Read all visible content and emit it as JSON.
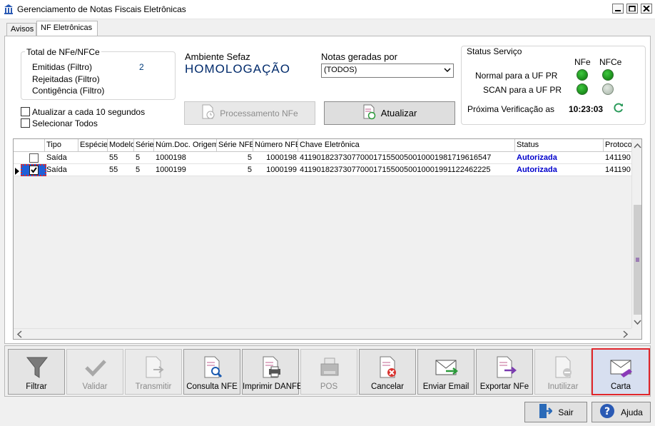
{
  "window": {
    "title": "Gerenciamento de Notas Fiscais Eletrônicas"
  },
  "tabs": [
    {
      "label": "Avisos",
      "active": false
    },
    {
      "label": "NF Eletrônicas",
      "active": true
    }
  ],
  "totals": {
    "title": "Total de NFe/NFCe",
    "emitidas_label": "Emitidas (Filtro)",
    "emitidas_value": "2",
    "rejeitadas_label": "Rejeitadas (Filtro)",
    "contingencia_label": "Contigência (Filtro)"
  },
  "options": {
    "auto_refresh_label": "Atualizar a cada 10 segundos",
    "select_all_label": "Selecionar Todos"
  },
  "ambiente": {
    "label": "Ambiente Sefaz",
    "value": "HOMOLOGAÇÃO"
  },
  "notas_geradas": {
    "label": "Notas geradas por",
    "selected": "(TODOS)"
  },
  "buttons": {
    "processamento": "Processamento NFe",
    "atualizar": "Atualizar"
  },
  "status_servico": {
    "title": "Status Serviço",
    "col_nfe": "NFe",
    "col_nfce": "NFCe",
    "rows": [
      {
        "label": "Normal para a UF PR",
        "nfe": "online",
        "nfce": "online"
      },
      {
        "label": "SCAN para a UF PR",
        "nfe": "online",
        "nfce": "offline"
      }
    ],
    "proxima_label": "Próxima Verificação as",
    "proxima_value": "10:23:03"
  },
  "grid": {
    "columns": [
      "Tipo",
      "Espécie",
      "Modelo",
      "Série",
      "Núm.Doc. Origem",
      "Série NFE",
      "Número NFE",
      "Chave Eletrônica",
      "Status",
      "Protoco"
    ],
    "rows": [
      {
        "selected": false,
        "current": false,
        "tipo": "Saída",
        "especie": "",
        "modelo": "55",
        "serie": "5",
        "num_doc": "1000198",
        "serie_nfe": "5",
        "numero_nfe": "1000198",
        "chave": "41190182373077000171550050010001981719616547",
        "status": "Autorizada",
        "protocolo": "141190"
      },
      {
        "selected": true,
        "current": true,
        "tipo": "Saída",
        "especie": "",
        "modelo": "55",
        "serie": "5",
        "num_doc": "1000199",
        "serie_nfe": "5",
        "numero_nfe": "1000199",
        "chave": "41190182373077000171550050010001991122462225",
        "status": "Autorizada",
        "protocolo": "141190"
      }
    ]
  },
  "toolbar": [
    {
      "label": "Filtrar",
      "icon": "filter-icon",
      "enabled": true
    },
    {
      "label": "Validar",
      "icon": "check-icon",
      "enabled": false
    },
    {
      "label": "Transmitir",
      "icon": "transmit-icon",
      "enabled": false
    },
    {
      "label": "Consulta NFE",
      "icon": "search-document-icon",
      "enabled": true
    },
    {
      "label": "Imprimir DANFE",
      "icon": "print-document-icon",
      "enabled": true
    },
    {
      "label": "POS",
      "icon": "pos-printer-icon",
      "enabled": false
    },
    {
      "label": "Cancelar",
      "icon": "cancel-document-icon",
      "enabled": true
    },
    {
      "label": "Enviar Email",
      "icon": "email-send-icon",
      "enabled": true
    },
    {
      "label": "Exportar NFe",
      "icon": "export-document-icon",
      "enabled": true
    },
    {
      "label": "Inutilizar",
      "icon": "void-document-icon",
      "enabled": false
    },
    {
      "label": "Carta",
      "icon": "letter-icon",
      "enabled": true
    }
  ],
  "footer": {
    "sair": "Sair",
    "ajuda": "Ajuda"
  },
  "colors": {
    "status_authorized": "#0000cc",
    "ambiente_text": "#002a6b",
    "emitidas_value": "#003b7a",
    "highlight_border": "#e0262b",
    "online_dot": "#1a8c1a",
    "offline_dot": "#b8c4b8"
  }
}
